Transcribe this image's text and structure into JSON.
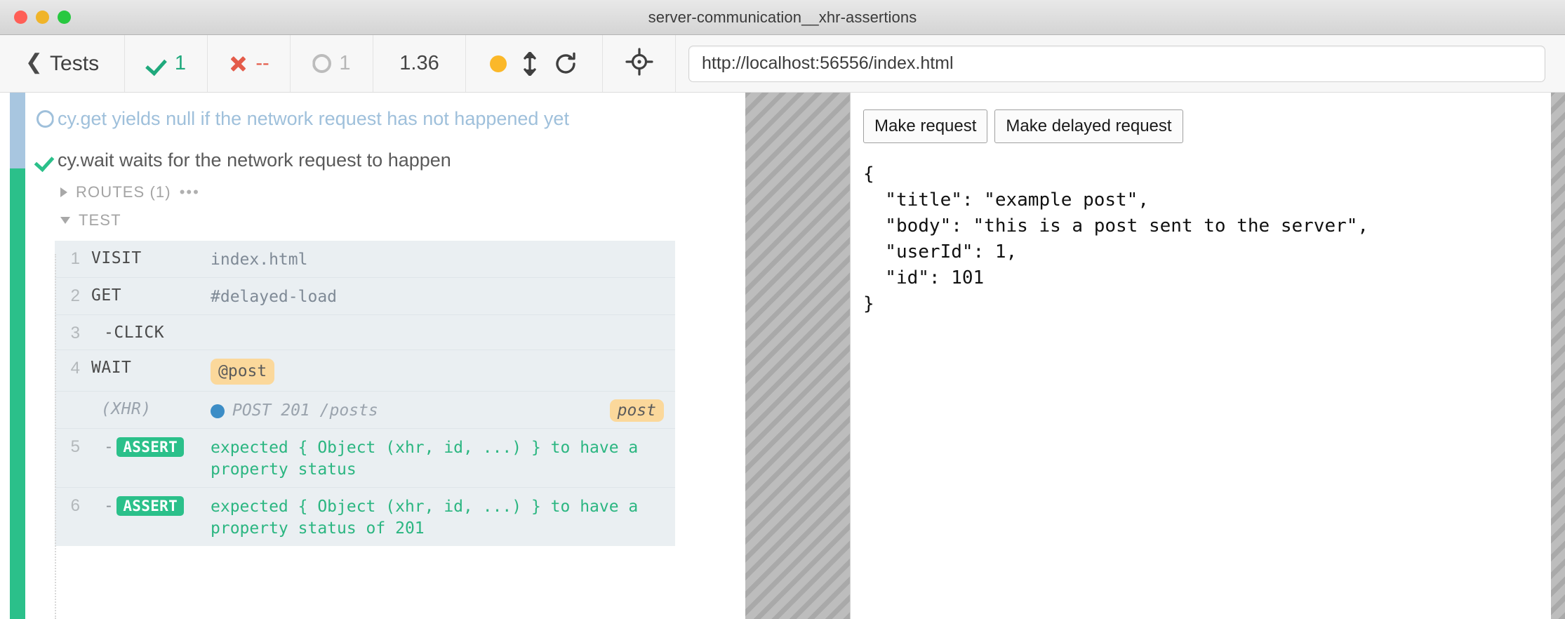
{
  "window": {
    "title": "server-communication__xhr-assertions",
    "traffic_lights": [
      "close",
      "minimize",
      "zoom"
    ]
  },
  "toolbar": {
    "back_label": "Tests",
    "back_icon": "chevron-left-icon",
    "stats": [
      {
        "key": "passed",
        "icon": "check-icon",
        "value": "1",
        "color": "#1fa97c"
      },
      {
        "key": "failed",
        "icon": "x-icon",
        "value": "--",
        "color": "#e45c4a"
      },
      {
        "key": "pending",
        "icon": "ring-icon",
        "value": "1",
        "color": "#b6b6b6"
      }
    ],
    "duration": "1.36",
    "controls": [
      {
        "name": "status-dot",
        "icon": "amber-dot-icon",
        "color": "#fbb829"
      },
      {
        "name": "auto-scroll-toggle",
        "icon": "up-down-arrow-icon"
      },
      {
        "name": "restart-button",
        "icon": "restart-icon"
      }
    ],
    "selector_playground_icon": "crosshair-icon",
    "url": "http://localhost:56556/index.html",
    "url_placeholder": "http://localhost:56556/index.html"
  },
  "reporter": {
    "tests": [
      {
        "state": "pending",
        "icon": "ring-icon",
        "title": "cy.get yields null if the network request has not happened yet"
      },
      {
        "state": "passed",
        "icon": "check-icon",
        "title": "cy.wait waits for the network request to happen"
      }
    ],
    "sections": [
      {
        "name": "routes",
        "label": "ROUTES (1)",
        "expanded": false,
        "menu": "•••"
      },
      {
        "name": "test",
        "label": "TEST",
        "expanded": true,
        "menu": ""
      }
    ],
    "commands": [
      {
        "num": "1",
        "name": "VISIT",
        "child": false,
        "message": "index.html",
        "type": "text"
      },
      {
        "num": "2",
        "name": "GET",
        "child": false,
        "message": "#delayed-load",
        "type": "text"
      },
      {
        "num": "3",
        "name": "-CLICK",
        "child": true,
        "message": "",
        "type": "text"
      },
      {
        "num": "4",
        "name": "WAIT",
        "child": false,
        "message": "@post",
        "type": "alias"
      },
      {
        "num": "",
        "name": "(XHR)",
        "child": false,
        "message": "POST 201 /posts",
        "type": "xhr",
        "method": "POST",
        "status": "201",
        "path": "/posts",
        "alias": "post",
        "dot_color": "#3c8dc6"
      },
      {
        "num": "5",
        "name": "ASSERT",
        "child": true,
        "type": "assert",
        "message": "expected { Object (xhr, id, ...) } to have a property status",
        "parts": [
          "expected ",
          "{ Object (xhr, id, ...) }",
          " to have a property ",
          "status"
        ]
      },
      {
        "num": "6",
        "name": "ASSERT",
        "child": true,
        "type": "assert",
        "message": "expected { Object (xhr, id, ...) } to have a property status of 201",
        "parts": [
          "expected ",
          "{ Object (xhr, id, ...) }",
          " to have a property ",
          "status",
          " of ",
          "201"
        ]
      }
    ],
    "assert_tag_label": "ASSERT"
  },
  "preview": {
    "buttons": [
      {
        "name": "make-request-button",
        "label": "Make request"
      },
      {
        "name": "make-delayed-request-button",
        "label": "Make delayed request"
      }
    ],
    "response_json": "{\n  \"title\": \"example post\",\n  \"body\": \"this is a post sent to the server\",\n  \"userId\": 1,\n  \"id\": 101\n}"
  }
}
